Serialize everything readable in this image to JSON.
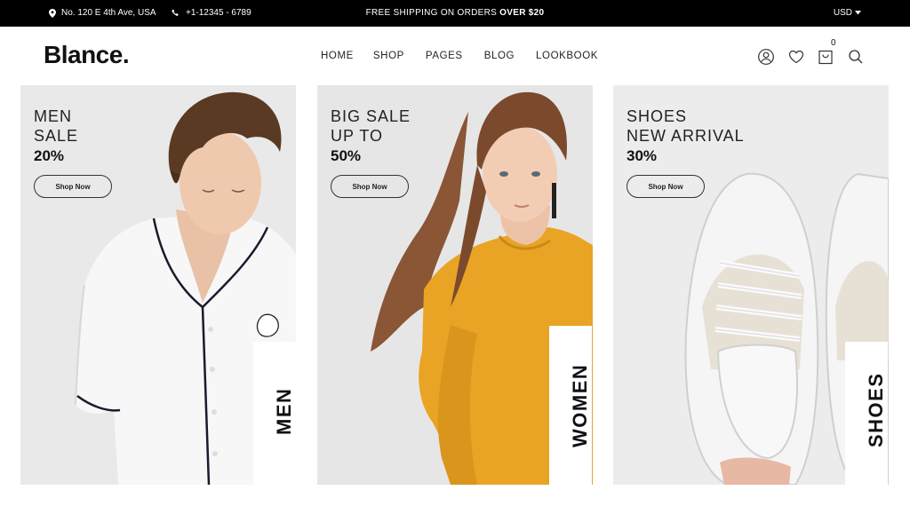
{
  "topbar": {
    "address": "No. 120 E 4th Ave, USA",
    "phone": "+1-12345 - 6789",
    "promo_text": "FREE SHIPPING ON ORDERS ",
    "promo_bold": "OVER $20",
    "currency": "USD"
  },
  "header": {
    "logo": "Blance.",
    "nav": [
      "HOME",
      "SHOP",
      "PAGES",
      "BLOG",
      "LOOKBOOK"
    ],
    "cart_count": "0"
  },
  "banners": [
    {
      "line1": "MEN",
      "line2": "SALE",
      "percent": "20%",
      "button": "Shop Now",
      "tag": "MEN"
    },
    {
      "line1": "BIG SALE",
      "line2": "UP TO",
      "percent": "50%",
      "button": "Shop Now",
      "tag": "WOMEN"
    },
    {
      "line1": "SHOES",
      "line2": "NEW ARRIVAL",
      "percent": "30%",
      "button": "Shop Now",
      "tag": "SHOES"
    }
  ],
  "icons": [
    "location-icon",
    "phone-icon",
    "caret-down-icon",
    "account-icon",
    "wishlist-heart-icon",
    "cart-bag-icon",
    "search-icon"
  ],
  "colors": {
    "topbar": "#000000",
    "accent_yellow": "#e8a423",
    "banner_bg": "#e8e8e8"
  }
}
